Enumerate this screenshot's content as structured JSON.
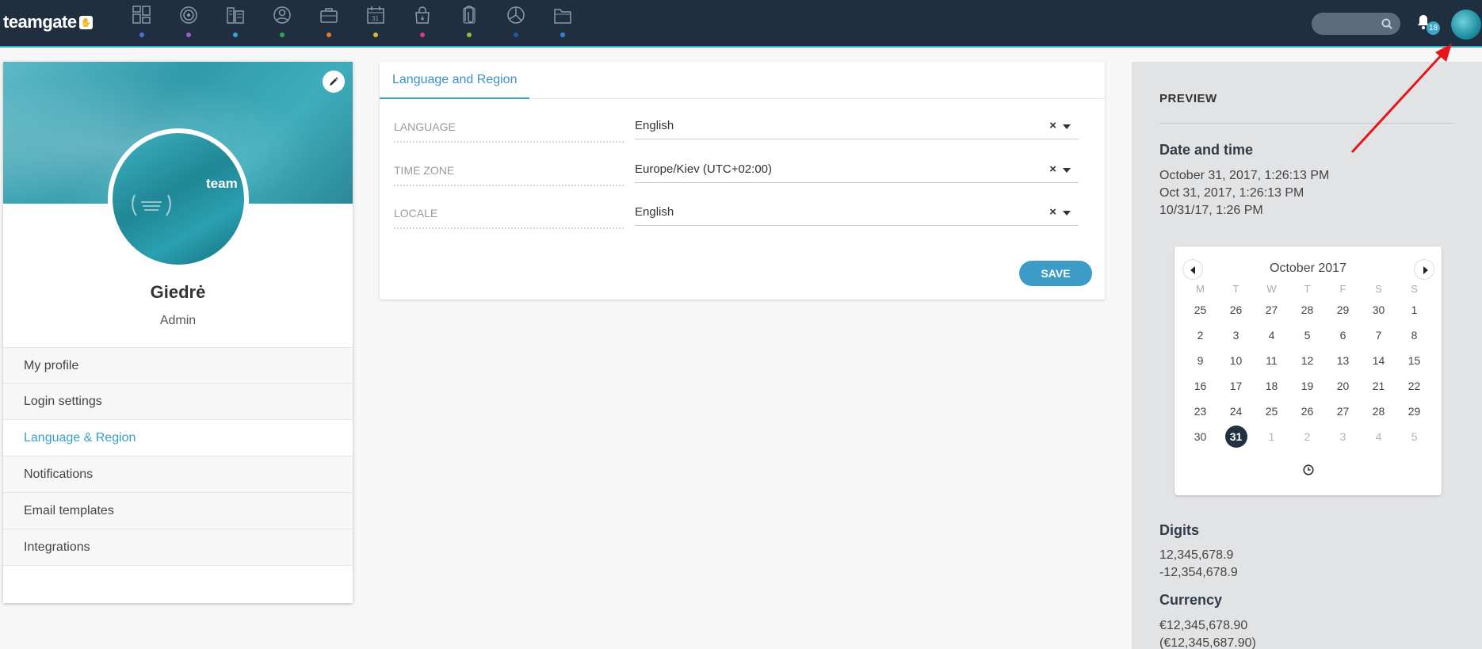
{
  "app": {
    "logo_text": "teamgate",
    "nav_icons": [
      {
        "name": "dashboard-icon",
        "dot_color": "#4a6fd8"
      },
      {
        "name": "target-icon",
        "dot_color": "#9b59d6"
      },
      {
        "name": "companies-icon",
        "dot_color": "#3ba0d8"
      },
      {
        "name": "people-icon",
        "dot_color": "#2ea84a"
      },
      {
        "name": "deals-icon",
        "dot_color": "#e07a2e"
      },
      {
        "name": "calendar-icon",
        "dot_color": "#e0b82e"
      },
      {
        "name": "shopping-bag-icon",
        "dot_color": "#d63a8a"
      },
      {
        "name": "attachment-icon",
        "dot_color": "#8ac22e"
      },
      {
        "name": "reports-icon",
        "dot_color": "#1f5aa8"
      },
      {
        "name": "folder-icon",
        "dot_color": "#3b7fd8"
      }
    ],
    "notification_count": "18"
  },
  "profile": {
    "name": "Giedrė",
    "role": "Admin",
    "avatar_logo_text": "team",
    "menu": [
      {
        "label": "My profile",
        "active": false
      },
      {
        "label": "Login settings",
        "active": false
      },
      {
        "label": "Language & Region",
        "active": true
      },
      {
        "label": "Notifications",
        "active": false
      },
      {
        "label": "Email templates",
        "active": false
      },
      {
        "label": "Integrations",
        "active": false
      }
    ]
  },
  "settings": {
    "tab_label": "Language and Region",
    "fields": [
      {
        "label": "LANGUAGE",
        "value": "English"
      },
      {
        "label": "TIME ZONE",
        "value": "Europe/Kiev (UTC+02:00)"
      },
      {
        "label": "LOCALE",
        "value": "English"
      }
    ],
    "clear_symbol": "×",
    "save_label": "SAVE"
  },
  "preview": {
    "heading": "PREVIEW",
    "date_time": {
      "title": "Date and time",
      "lines": [
        "October 31, 2017, 1:26:13 PM",
        "Oct 31, 2017, 1:26:13 PM",
        "10/31/17, 1:26 PM"
      ]
    },
    "calendar": {
      "month_label": "October 2017",
      "weekdays": [
        "M",
        "T",
        "W",
        "T",
        "F",
        "S",
        "S"
      ],
      "weeks": [
        [
          {
            "d": "25",
            "m": false
          },
          {
            "d": "26",
            "m": false
          },
          {
            "d": "27",
            "m": false
          },
          {
            "d": "28",
            "m": false
          },
          {
            "d": "29",
            "m": false
          },
          {
            "d": "30",
            "m": false
          },
          {
            "d": "1",
            "m": false
          }
        ],
        [
          {
            "d": "2",
            "m": false
          },
          {
            "d": "3",
            "m": false
          },
          {
            "d": "4",
            "m": false
          },
          {
            "d": "5",
            "m": false
          },
          {
            "d": "6",
            "m": false
          },
          {
            "d": "7",
            "m": false
          },
          {
            "d": "8",
            "m": false
          }
        ],
        [
          {
            "d": "9",
            "m": false
          },
          {
            "d": "10",
            "m": false
          },
          {
            "d": "11",
            "m": false
          },
          {
            "d": "12",
            "m": false
          },
          {
            "d": "13",
            "m": false
          },
          {
            "d": "14",
            "m": false
          },
          {
            "d": "15",
            "m": false
          }
        ],
        [
          {
            "d": "16",
            "m": false
          },
          {
            "d": "17",
            "m": false
          },
          {
            "d": "18",
            "m": false
          },
          {
            "d": "19",
            "m": false
          },
          {
            "d": "20",
            "m": false
          },
          {
            "d": "21",
            "m": false
          },
          {
            "d": "22",
            "m": false
          }
        ],
        [
          {
            "d": "23",
            "m": false
          },
          {
            "d": "24",
            "m": false
          },
          {
            "d": "25",
            "m": false
          },
          {
            "d": "26",
            "m": false
          },
          {
            "d": "27",
            "m": false
          },
          {
            "d": "28",
            "m": false
          },
          {
            "d": "29",
            "m": false
          }
        ],
        [
          {
            "d": "30",
            "m": false
          },
          {
            "d": "31",
            "m": false,
            "selected": true
          },
          {
            "d": "1",
            "m": true
          },
          {
            "d": "2",
            "m": true
          },
          {
            "d": "3",
            "m": true
          },
          {
            "d": "4",
            "m": true
          },
          {
            "d": "5",
            "m": true
          }
        ]
      ]
    },
    "digits": {
      "title": "Digits",
      "lines": [
        "12,345,678.9",
        "-12,354,678.9"
      ]
    },
    "currency": {
      "title": "Currency",
      "lines": [
        "€12,345,678.90",
        "(€12,345,687.90)"
      ]
    }
  },
  "colors": {
    "topbar": "#1f2f40",
    "accent": "#3ba0c5",
    "annotation_arrow": "#e8141c"
  }
}
